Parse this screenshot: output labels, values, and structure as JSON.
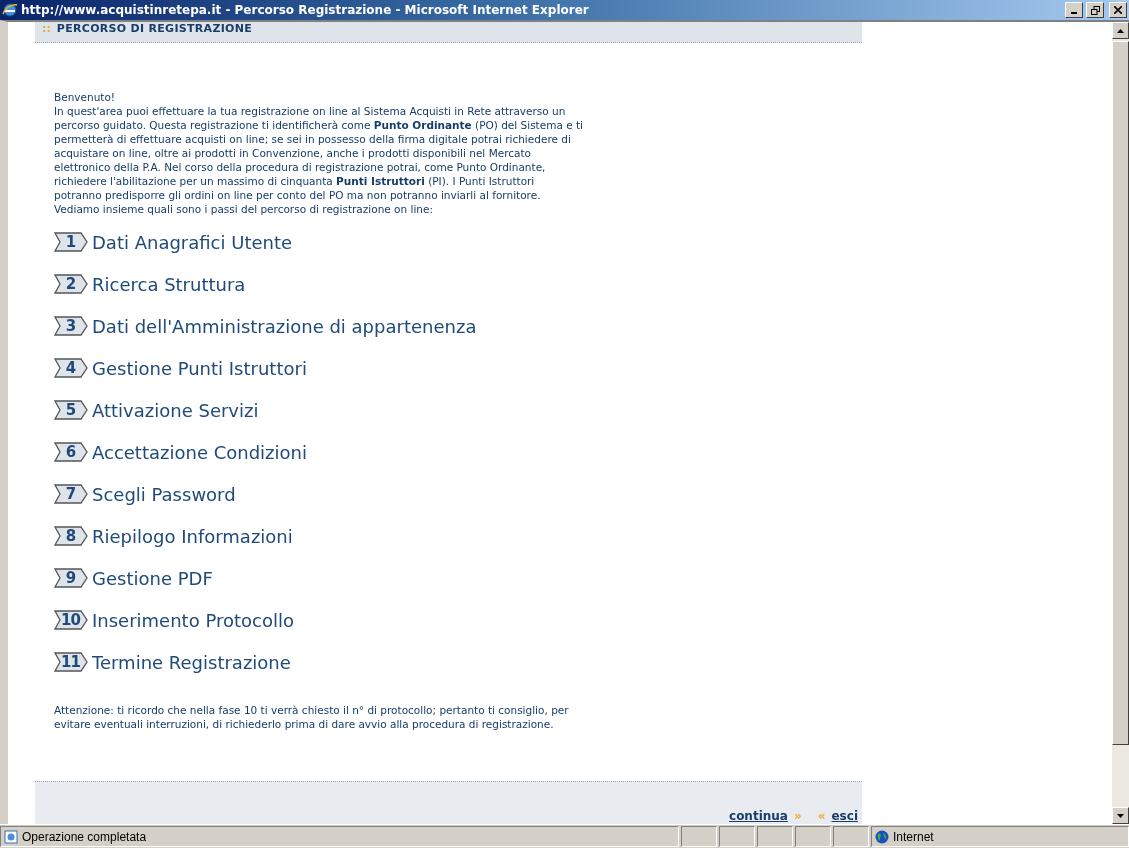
{
  "window": {
    "title": "http://www.acquistinretepa.it - Percorso Registrazione - Microsoft Internet Explorer"
  },
  "header": {
    "marker": "::",
    "title": "PERCORSO DI REGISTRAZIONE"
  },
  "intro_lines": [
    "Benvenuto!",
    "In quest'area puoi effettuare la tua registrazione on line al Sistema Acquisti in Rete attraverso un",
    "percorso guidato. Questa registrazione ti identificherà come **Punto Ordinante** (PO) del Sistema e ti",
    "permetterà di effettuare acquisti on line; se sei in possesso della firma digitale potrai richiedere di",
    "acquistare on line, oltre ai prodotti in Convenzione, anche i prodotti disponibili nel Mercato",
    "elettronico della P.A. Nel corso della procedura di registrazione potrai, come Punto Ordinante,",
    "richiedere l'abilitazione per un massimo di cinquanta **Punti Istruttori** (PI). I Punti Istruttori",
    "potranno predisporre gli ordini on line per conto del PO ma non potranno inviarli al fornitore.",
    "Vediamo insieme quali sono i passi del percorso di registrazione on line:"
  ],
  "steps": [
    {
      "number": "1",
      "label": "Dati Anagrafici Utente"
    },
    {
      "number": "2",
      "label": "Ricerca Struttura"
    },
    {
      "number": "3",
      "label": "Dati dell'Amministrazione di appartenenza"
    },
    {
      "number": "4",
      "label": "Gestione Punti Istruttori"
    },
    {
      "number": "5",
      "label": "Attivazione Servizi"
    },
    {
      "number": "6",
      "label": "Accettazione Condizioni"
    },
    {
      "number": "7",
      "label": "Scegli Password"
    },
    {
      "number": "8",
      "label": "Riepilogo Informazioni"
    },
    {
      "number": "9",
      "label": "Gestione PDF"
    },
    {
      "number": "10",
      "label": "Inserimento Protocollo"
    },
    {
      "number": "11",
      "label": "Termine Registrazione"
    }
  ],
  "note_lines": [
    "Attenzione: ti ricordo che nella fase 10 ti verrà chiesto il n° di protocollo; pertanto ti consiglio, per",
    "evitare eventuali interruzioni, di richiederlo prima di dare avvio alla procedura di registrazione."
  ],
  "footer": {
    "continue_link": "continua",
    "continue_arrow": "»",
    "exit_arrow": "«",
    "exit_link": "esci"
  },
  "status_bar": {
    "text": "Operazione completata",
    "zone": "Internet"
  }
}
